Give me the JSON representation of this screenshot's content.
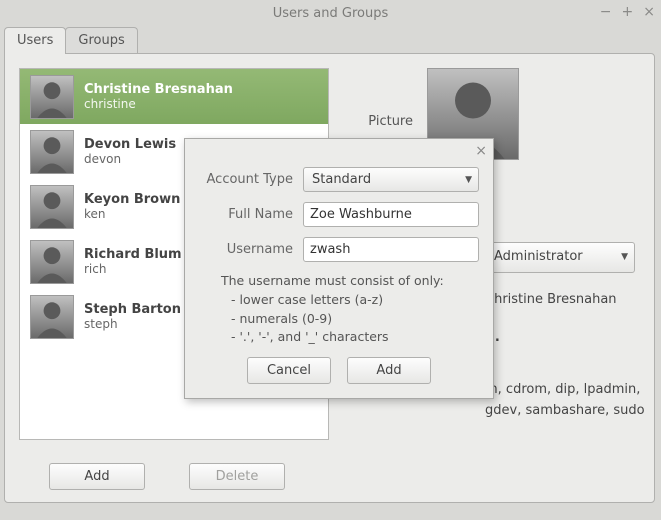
{
  "window": {
    "title": "Users and Groups",
    "tabs": [
      "Users",
      "Groups"
    ],
    "active_tab": 0
  },
  "users": [
    {
      "name": "Christine Bresnahan",
      "login": "christine",
      "selected": true
    },
    {
      "name": "Devon Lewis",
      "login": "devon",
      "selected": false
    },
    {
      "name": "Keyon Brown",
      "login": "ken",
      "selected": false
    },
    {
      "name": "Richard Blum",
      "login": "rich",
      "selected": false
    },
    {
      "name": "Steph Barton",
      "login": "steph",
      "selected": false
    }
  ],
  "detail": {
    "picture_label": "Picture",
    "account_type_label": "Account Type",
    "account_type_value": "Administrator",
    "full_name_value": "Christine Bresnahan",
    "password_placeholder": "...",
    "groups_value": "m, cdrom, dip, lpadmin, gdev, sambashare, sudo"
  },
  "buttons": {
    "add": "Add",
    "delete": "Delete"
  },
  "dialog": {
    "account_type_label": "Account Type",
    "account_type_value": "Standard",
    "full_name_label": "Full Name",
    "full_name_value": "Zoe Washburne",
    "username_label": "Username",
    "username_value": "zwash",
    "hint_title": "The username must consist of only:",
    "hint_lines": [
      "- lower case letters (a-z)",
      "- numerals (0-9)",
      "- '.', '-', and '_' characters"
    ],
    "cancel": "Cancel",
    "add": "Add"
  }
}
